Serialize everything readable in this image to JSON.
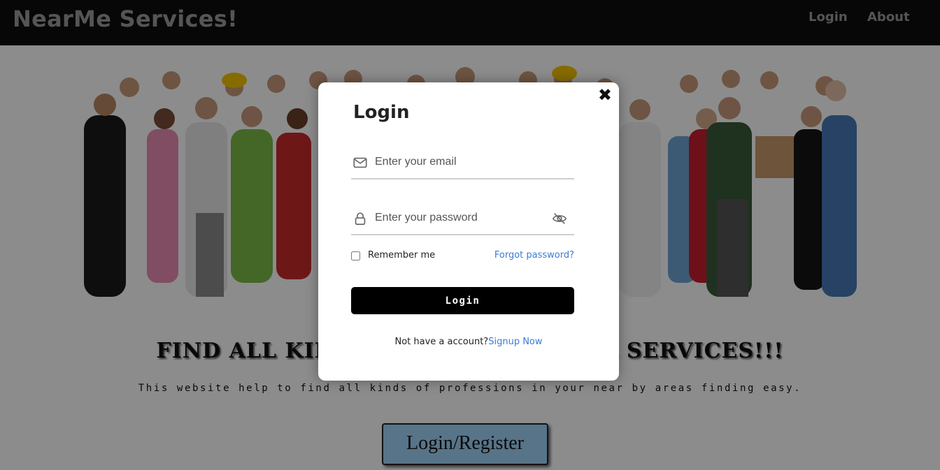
{
  "navbar": {
    "brand": "NearMe Services!",
    "login_link": "Login",
    "about_link": "About"
  },
  "hero": {
    "headline": "FIND ALL KINDS OF PROFESSIONAL SERVICES!!!",
    "tagline": "This website help to find all kinds of professions in your near by areas finding easy.",
    "cta_label": "Login/Register"
  },
  "modal": {
    "title": "Login",
    "email_placeholder": "Enter your email",
    "password_placeholder": "Enter your password",
    "remember_label": "Remember me",
    "forgot_label": "Forgot password?",
    "login_button": "Login",
    "signup_prompt": "Not have a account?",
    "signup_link": "Signup Now"
  },
  "colors": {
    "navbar_bg": "#0e0e0e",
    "link_blue": "#3a7bd5",
    "button_black": "#000000",
    "cta_blue": "#9ed3f7"
  },
  "icons": {
    "close": "close-icon",
    "email": "envelope-icon",
    "password": "lock-icon",
    "toggle": "eye-slash-icon"
  }
}
